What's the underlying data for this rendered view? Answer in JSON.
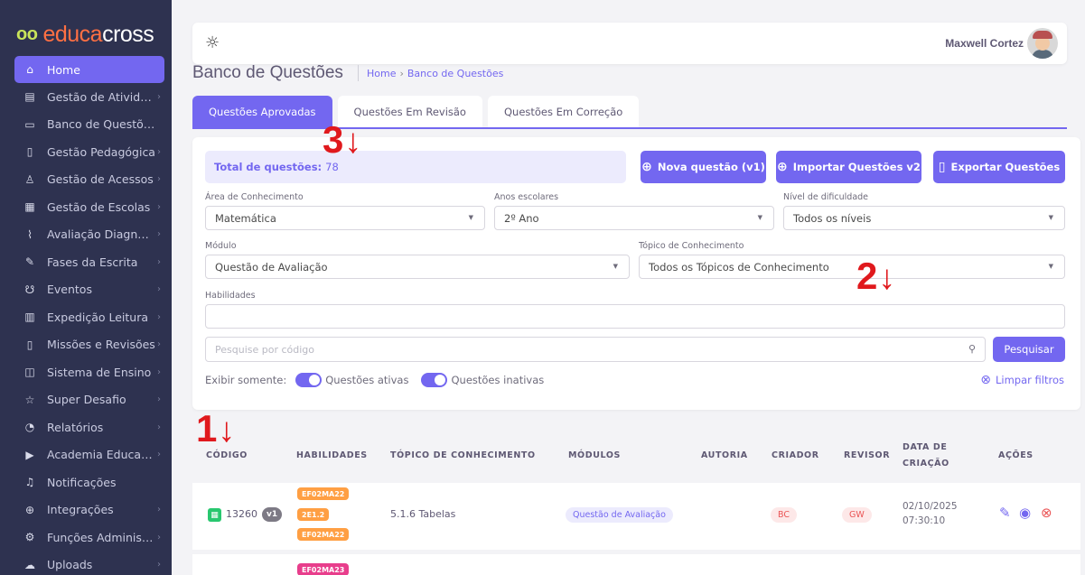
{
  "brand": {
    "mark": "oo",
    "part1": "educa",
    "part2": "cross"
  },
  "sidebar": {
    "items": [
      {
        "label": "Home",
        "icon": "home-icon",
        "glyph": "⌂",
        "active": true,
        "arrow": false
      },
      {
        "label": "Gestão de Atividades",
        "icon": "file-icon",
        "glyph": "▤",
        "active": false,
        "arrow": true
      },
      {
        "label": "Banco de Questões",
        "icon": "archive-icon",
        "glyph": "▭",
        "active": false,
        "arrow": false
      },
      {
        "label": "Gestão Pedagógica",
        "icon": "book-icon",
        "glyph": "▯",
        "active": false,
        "arrow": true
      },
      {
        "label": "Gestão de Acessos",
        "icon": "user-icon",
        "glyph": "♙",
        "active": false,
        "arrow": true
      },
      {
        "label": "Gestão de Escolas",
        "icon": "grid-icon",
        "glyph": "▦",
        "active": false,
        "arrow": true
      },
      {
        "label": "Avaliação Diagnósti...",
        "icon": "flask-icon",
        "glyph": "⌇",
        "active": false,
        "arrow": true
      },
      {
        "label": "Fases da Escrita",
        "icon": "pen-icon",
        "glyph": "✎",
        "active": false,
        "arrow": true
      },
      {
        "label": "Eventos",
        "icon": "award-icon",
        "glyph": "☋",
        "active": false,
        "arrow": true
      },
      {
        "label": "Expedição Leitura",
        "icon": "clipboard-icon",
        "glyph": "▥",
        "active": false,
        "arrow": true
      },
      {
        "label": "Missões e Revisões",
        "icon": "tablet-icon",
        "glyph": "▯",
        "active": false,
        "arrow": true
      },
      {
        "label": "Sistema de Ensino",
        "icon": "open-book-icon",
        "glyph": "◫",
        "active": false,
        "arrow": true
      },
      {
        "label": "Super Desafio",
        "icon": "star-icon",
        "glyph": "☆",
        "active": false,
        "arrow": true
      },
      {
        "label": "Relatórios",
        "icon": "pie-chart-icon",
        "glyph": "◔",
        "active": false,
        "arrow": true
      },
      {
        "label": "Academia Educacr...",
        "icon": "video-icon",
        "glyph": "▶",
        "active": false,
        "arrow": true
      },
      {
        "label": "Notificações",
        "icon": "bell-icon",
        "glyph": "♫",
        "active": false,
        "arrow": false
      },
      {
        "label": "Integrações",
        "icon": "globe-icon",
        "glyph": "⊕",
        "active": false,
        "arrow": true
      },
      {
        "label": "Funções Administr...",
        "icon": "settings-icon",
        "glyph": "⚙",
        "active": false,
        "arrow": true
      },
      {
        "label": "Uploads",
        "icon": "upload-icon",
        "glyph": "☁",
        "active": false,
        "arrow": true
      }
    ]
  },
  "topbar": {
    "theme_icon": "sun-icon",
    "user_name": "Maxwell Cortez"
  },
  "header": {
    "title": "Banco de Questões",
    "breadcrumb": [
      "Home",
      "Banco de Questões"
    ]
  },
  "tabs": [
    "Questões Aprovadas",
    "Questões Em Revisão",
    "Questões Em Correção"
  ],
  "filters": {
    "total_label": "Total de questões:",
    "total_value": "78",
    "btn_new": "Nova questão (v1)",
    "btn_import": "Importar Questões v2",
    "btn_export": "Exportar Questões",
    "area_label": "Área de Conhecimento",
    "area_value": "Matemática",
    "years_label": "Anos escolares",
    "years_value": "2º Ano",
    "difficulty_label": "Nível de dificuldade",
    "difficulty_value": "Todos os níveis",
    "module_label": "Módulo",
    "module_value": "Questão de Avaliação",
    "topic_label": "Tópico de Conhecimento",
    "topic_value": "Todos os Tópicos de Conhecimento",
    "skills_label": "Habilidades",
    "search_placeholder": "Pesquise por código",
    "search_button": "Pesquisar",
    "show_only": "Exibir somente:",
    "active_label": "Questões ativas",
    "inactive_label": "Questões inativas",
    "clear": "Limpar filtros"
  },
  "table": {
    "headers": {
      "code": "CÓDIGO",
      "skills": "HABILIDADES",
      "topic": "TÓPICO DE CONHECIMENTO",
      "modules": "MÓDULOS",
      "author": "AUTORIA",
      "creator": "CRIADOR",
      "reviewer": "REVISOR",
      "date1": "DATA DE",
      "date2": "CRIAÇÃO",
      "actions": "AÇÕES"
    },
    "rows": [
      {
        "code": "13260",
        "version": "v1",
        "skills": [
          "EF02MA22",
          "2E1.2",
          "EF02MA22"
        ],
        "topic": "5.1.6 Tabelas",
        "module": "Questão de Avaliação",
        "creator": "BC",
        "reviewer": "GW",
        "date": "02/10/2025",
        "time": "07:30:10"
      },
      {
        "skills": [
          "EF02MA23"
        ]
      }
    ]
  },
  "annotations": [
    "1",
    "2",
    "3"
  ],
  "colors": {
    "primary": "#7367f0",
    "sidebar": "#2e3250",
    "orange": "#ff9f43",
    "pink": "#e83e8c",
    "danger": "#ea5455"
  }
}
